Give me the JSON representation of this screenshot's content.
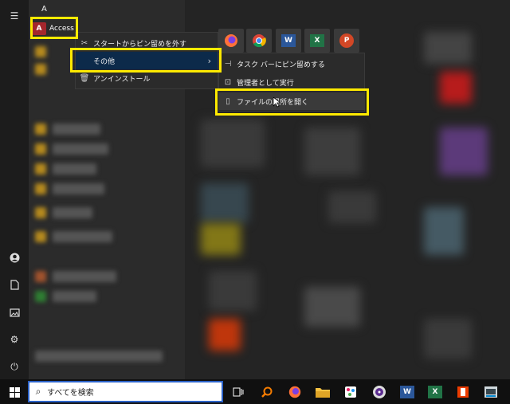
{
  "start_menu": {
    "section_letter": "A",
    "app_entry": {
      "label": "Access",
      "icon": "access-icon",
      "icon_letter": "A"
    }
  },
  "context_menu": {
    "items": [
      {
        "label": "スタートからピン留めを外す",
        "icon": "unpin-icon"
      },
      {
        "label": "その他",
        "icon": "",
        "has_submenu": true
      },
      {
        "label": "アンインストール",
        "icon": "trash-icon"
      }
    ]
  },
  "submenu": {
    "items": [
      {
        "label": "タスク バーにピン留めする",
        "icon": "pin-icon"
      },
      {
        "label": "管理者として実行",
        "icon": "admin-icon"
      },
      {
        "label": "ファイルの場所を開く",
        "icon": "folder-open-icon"
      }
    ]
  },
  "pinned_tiles": [
    {
      "icon": "firefox-icon"
    },
    {
      "icon": "chrome-icon"
    },
    {
      "icon": "word-icon",
      "letter": "W"
    },
    {
      "icon": "excel-icon",
      "letter": "X"
    },
    {
      "icon": "powerpoint-icon",
      "letter": "P"
    }
  ],
  "taskbar": {
    "search_placeholder": "すべてを検索",
    "icons": [
      "start-icon",
      "task-view-icon",
      "search-app-icon",
      "firefox-icon",
      "file-explorer-icon",
      "paint-icon",
      "media-icon",
      "word-icon",
      "excel-icon",
      "office-icon",
      "remote-icon"
    ]
  },
  "colors": {
    "highlight": "#ffea00",
    "menu_bg": "#2b2b2b",
    "selected_item": "#0c2a4a",
    "access": "#a4262c",
    "word": "#2b579a",
    "excel": "#217346",
    "powerpoint": "#d24726"
  }
}
